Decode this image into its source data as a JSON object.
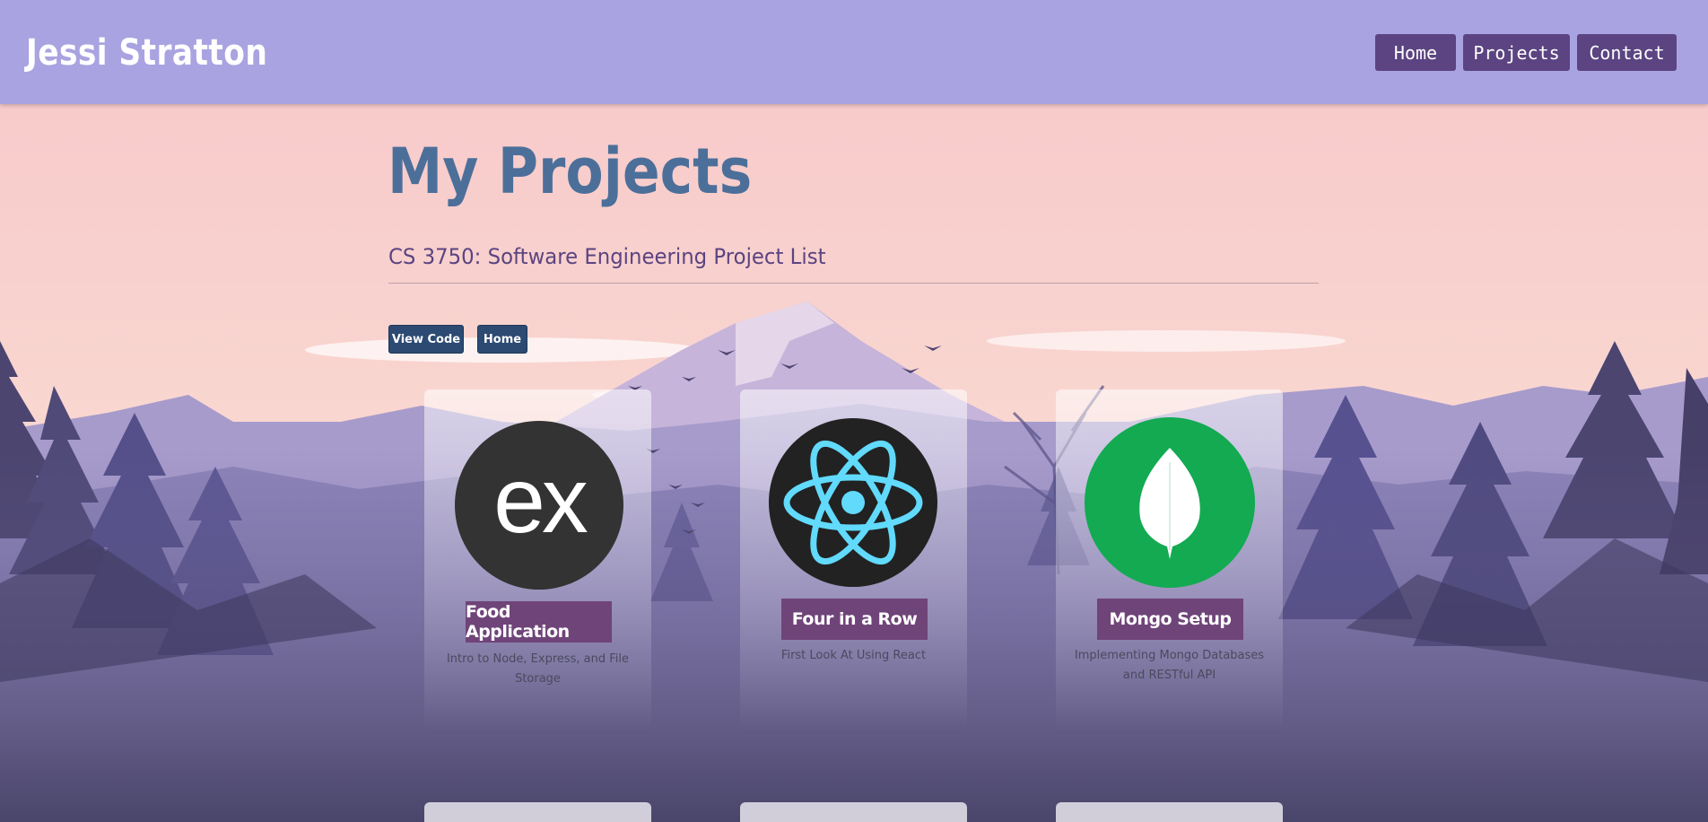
{
  "nav": {
    "brand": "Jessi Stratton",
    "links": [
      "Home",
      "Projects",
      "Contact"
    ]
  },
  "page": {
    "title": "My Projects",
    "subtitle": "CS 3750: Software Engineering Project List",
    "buttons": [
      "View Code",
      "Home"
    ]
  },
  "cards": [
    {
      "logo": "express-logo",
      "logo_text": "ex",
      "label": "Food Application",
      "description": "Intro to Node, Express, and File Storage"
    },
    {
      "logo": "react-logo-icon",
      "label": "Four in a Row",
      "description": "First Look At Using React"
    },
    {
      "logo": "mongodb-leaf-icon",
      "label": "Mongo Setup",
      "description": "Implementing Mongo Databases and RESTful API"
    }
  ],
  "colors": {
    "navbar": "#a9a3e1",
    "nav_button": "#5b4481",
    "title": "#4c6f9a",
    "subtitle": "#5b4481",
    "small_button": "#2c4a72",
    "card_label": "#6f4479",
    "express_circle": "#333333",
    "react_circle": "#222222",
    "react_blue": "#61dafb",
    "mongo_circle": "#13aa52"
  }
}
